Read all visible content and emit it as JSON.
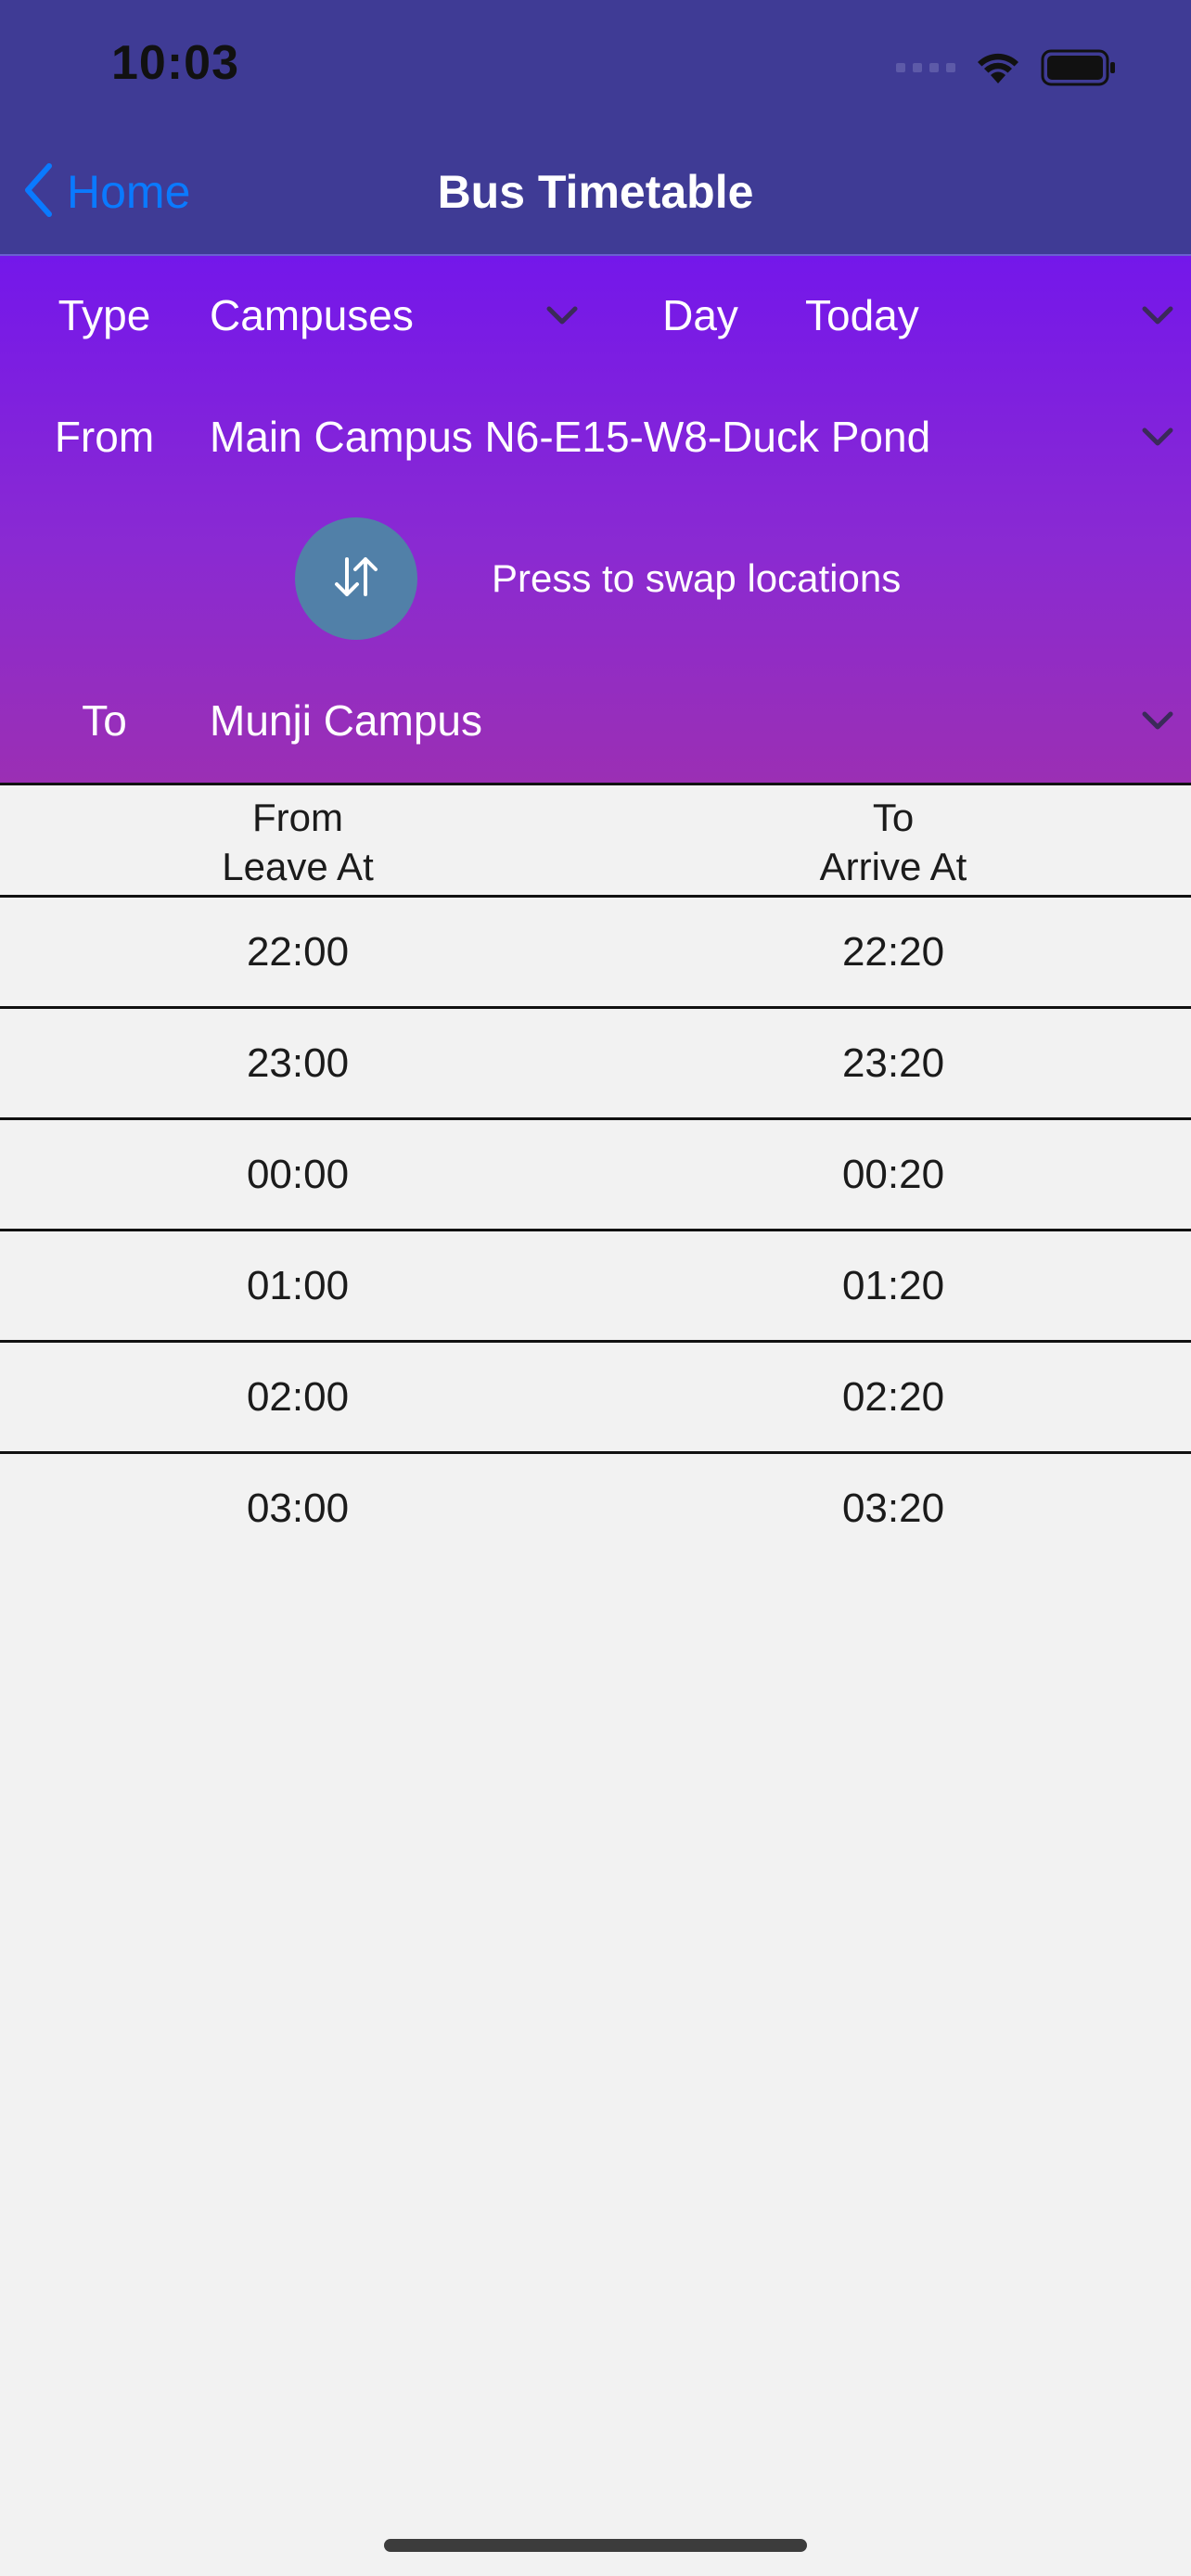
{
  "status_bar": {
    "time": "10:03"
  },
  "nav": {
    "back_label": "Home",
    "title": "Bus Timetable"
  },
  "filters": {
    "type_label": "Type",
    "type_value": "Campuses",
    "day_label": "Day",
    "day_value": "Today",
    "from_label": "From",
    "from_value": "Main Campus N6-E15-W8-Duck Pond",
    "swap_caption": "Press to swap locations",
    "to_label": "To",
    "to_value": "Munji Campus"
  },
  "timetable": {
    "headers": {
      "from_line1": "From",
      "from_line2": "Leave At",
      "to_line1": "To",
      "to_line2": "Arrive At"
    },
    "rows": [
      {
        "leave": "22:00",
        "arrive": "22:20"
      },
      {
        "leave": "23:00",
        "arrive": "23:20"
      },
      {
        "leave": "00:00",
        "arrive": "00:20"
      },
      {
        "leave": "01:00",
        "arrive": "01:20"
      },
      {
        "leave": "02:00",
        "arrive": "02:20"
      },
      {
        "leave": "03:00",
        "arrive": "03:20"
      }
    ]
  },
  "colors": {
    "nav_background": "#3f3b95",
    "back_link": "#0a7aff",
    "gradient_top": "#7417ea",
    "gradient_bottom": "#9b2fb4",
    "swap_button": "#5180a8",
    "table_background": "#f2f2f2"
  },
  "icons": {
    "back": "chevron-left-icon",
    "dropdown": "chevron-down-icon",
    "swap": "swap-arrows-icon",
    "wifi": "wifi-icon",
    "battery": "battery-icon",
    "signal": "cellular-signal-icon"
  }
}
